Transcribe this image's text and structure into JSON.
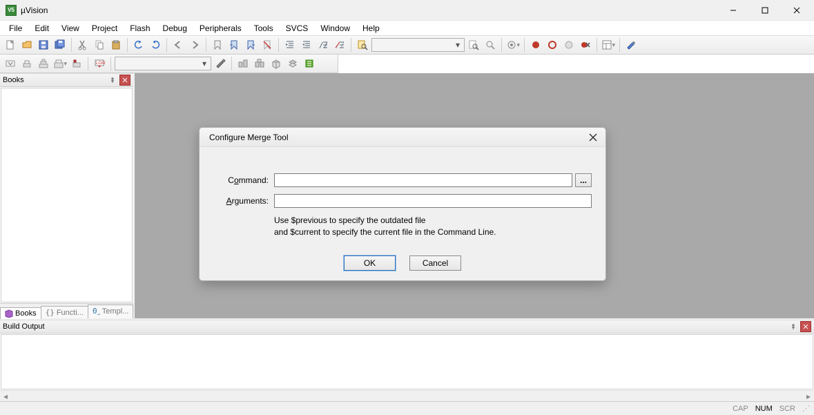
{
  "window": {
    "title": "µVision",
    "appicon_label": "V5"
  },
  "menus": [
    "File",
    "Edit",
    "View",
    "Project",
    "Flash",
    "Debug",
    "Peripherals",
    "Tools",
    "SVCS",
    "Window",
    "Help"
  ],
  "side_panel": {
    "title": "Books",
    "tabs": [
      {
        "icon": "books-icon",
        "label": "Books",
        "active": true
      },
      {
        "icon": "braces-icon",
        "label": "Functi...",
        "active": false
      },
      {
        "icon": "template-icon",
        "label": "Templ...",
        "active": false
      }
    ]
  },
  "dialog": {
    "title": "Configure Merge Tool",
    "command_label_pre": "C",
    "command_label_ul": "o",
    "command_label_post": "mmand:",
    "command_value": "",
    "browse_label": "...",
    "arguments_label_pre": "",
    "arguments_label_ul": "A",
    "arguments_label_post": "rguments:",
    "arguments_value": "",
    "hint_line1": "Use $previous to specify the outdated file",
    "hint_line2": "and $current to specify the current file in the Command Line.",
    "ok_label": "OK",
    "cancel_label": "Cancel"
  },
  "build_output": {
    "title": "Build Output"
  },
  "status": {
    "cap": "CAP",
    "num": "NUM",
    "scr": "SCR"
  }
}
